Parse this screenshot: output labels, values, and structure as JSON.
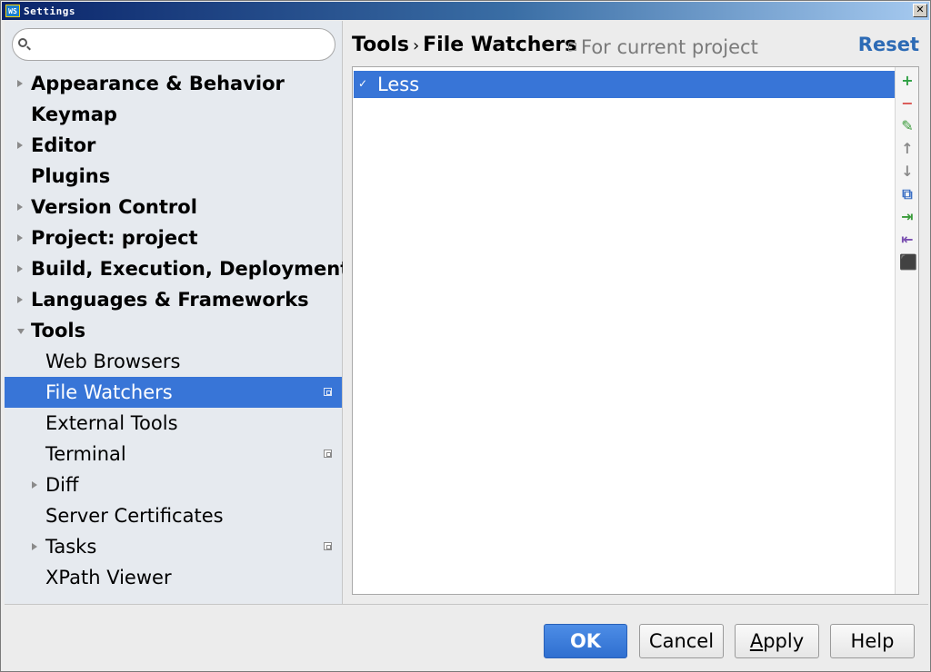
{
  "window": {
    "title": "Settings",
    "app_icon_text": "WS",
    "close_glyph": "✕"
  },
  "search": {
    "value": "",
    "placeholder": ""
  },
  "sidebar": {
    "items": [
      {
        "label": "Appearance & Behavior",
        "level": 0,
        "arrow": "right",
        "project_icon": false,
        "selected": false
      },
      {
        "label": "Keymap",
        "level": 0,
        "arrow": "none",
        "project_icon": false,
        "selected": false
      },
      {
        "label": "Editor",
        "level": 0,
        "arrow": "right",
        "project_icon": false,
        "selected": false
      },
      {
        "label": "Plugins",
        "level": 0,
        "arrow": "none",
        "project_icon": false,
        "selected": false
      },
      {
        "label": "Version Control",
        "level": 0,
        "arrow": "right",
        "project_icon": false,
        "selected": false
      },
      {
        "label": "Project: project",
        "level": 0,
        "arrow": "right",
        "project_icon": false,
        "selected": false
      },
      {
        "label": "Build, Execution, Deployment",
        "level": 0,
        "arrow": "right",
        "project_icon": false,
        "selected": false
      },
      {
        "label": "Languages & Frameworks",
        "level": 0,
        "arrow": "right",
        "project_icon": false,
        "selected": false
      },
      {
        "label": "Tools",
        "level": 0,
        "arrow": "down",
        "project_icon": false,
        "selected": false
      },
      {
        "label": "Web Browsers",
        "level": 1,
        "arrow": "none",
        "project_icon": false,
        "selected": false
      },
      {
        "label": "File Watchers",
        "level": 1,
        "arrow": "none",
        "project_icon": true,
        "selected": true
      },
      {
        "label": "External Tools",
        "level": 1,
        "arrow": "none",
        "project_icon": false,
        "selected": false
      },
      {
        "label": "Terminal",
        "level": 1,
        "arrow": "none",
        "project_icon": true,
        "selected": false
      },
      {
        "label": "Diff",
        "level": 1,
        "arrow": "right",
        "project_icon": false,
        "selected": false
      },
      {
        "label": "Server Certificates",
        "level": 1,
        "arrow": "none",
        "project_icon": false,
        "selected": false
      },
      {
        "label": "Tasks",
        "level": 1,
        "arrow": "right",
        "project_icon": true,
        "selected": false
      },
      {
        "label": "XPath Viewer",
        "level": 1,
        "arrow": "none",
        "project_icon": false,
        "selected": false
      }
    ]
  },
  "header": {
    "breadcrumb": [
      "Tools",
      "File Watchers"
    ],
    "separator": "›",
    "scope_label": "For current project",
    "reset_label": "Reset"
  },
  "watchers": {
    "rows": [
      {
        "label": "Less",
        "checked": true,
        "check_glyph": "✓"
      }
    ]
  },
  "toolbar": {
    "buttons": [
      {
        "name": "add-icon",
        "glyph": "+",
        "color": "#2ea043",
        "enabled": true
      },
      {
        "name": "remove-icon",
        "glyph": "−",
        "color": "#d9534f",
        "enabled": true
      },
      {
        "name": "edit-icon",
        "glyph": "✎",
        "color": "#3a9b3a",
        "enabled": true
      },
      {
        "name": "move-up-icon",
        "glyph": "↑",
        "color": "#8a8a8a",
        "enabled": true
      },
      {
        "name": "move-down-icon",
        "glyph": "↓",
        "color": "#8a8a8a",
        "enabled": true
      },
      {
        "name": "copy-icon",
        "glyph": "⧉",
        "color": "#3b6fc4",
        "enabled": true
      },
      {
        "name": "import-icon",
        "glyph": "⇥",
        "color": "#3a9b3a",
        "enabled": true
      },
      {
        "name": "export-icon",
        "glyph": "⇤",
        "color": "#7a4fb0",
        "enabled": true
      },
      {
        "name": "stamp-icon",
        "glyph": "⬛",
        "color": "#b8b8b8",
        "enabled": false
      }
    ]
  },
  "footer": {
    "ok_label": "OK",
    "cancel_label": "Cancel",
    "apply_mnemonic": "A",
    "apply_rest": "pply",
    "help_label": "Help"
  },
  "colors": {
    "selection": "#3875d7",
    "accent": "#2d6bb5"
  }
}
